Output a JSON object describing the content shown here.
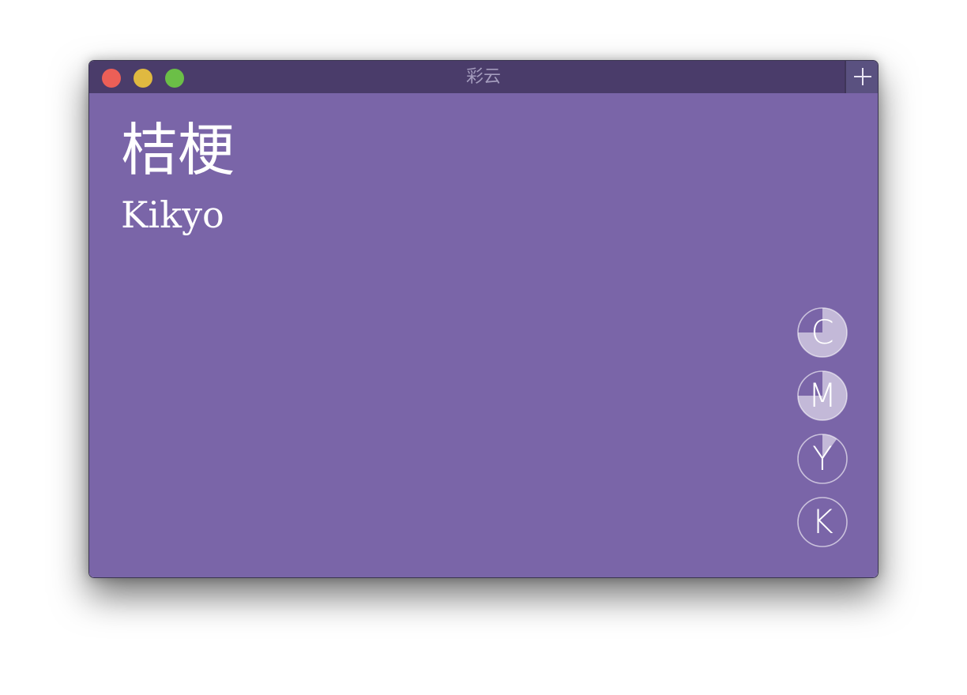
{
  "window": {
    "title": "彩云",
    "add_label": "+"
  },
  "traffic_lights": {
    "close_color": "#ec5f57",
    "minimize_color": "#e0b940",
    "zoom_color": "#6bbf47"
  },
  "color": {
    "name_cn": "桔梗",
    "name_en": "Kikyo",
    "background": "#7a65a8"
  },
  "cmyk": [
    {
      "letter": "C",
      "fraction": 0.75
    },
    {
      "letter": "M",
      "fraction": 0.75
    },
    {
      "letter": "Y",
      "fraction": 0.1
    },
    {
      "letter": "K",
      "fraction": 0
    }
  ]
}
